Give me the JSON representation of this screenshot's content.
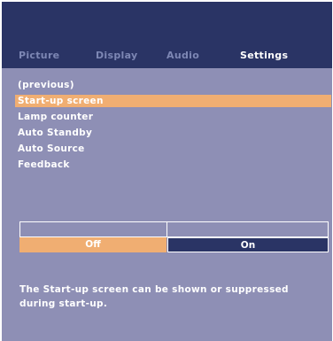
{
  "tabs": [
    {
      "label": "Picture",
      "active": false
    },
    {
      "label": "Display",
      "active": false
    },
    {
      "label": "Audio",
      "active": false
    },
    {
      "label": "Settings",
      "active": true
    }
  ],
  "menu": {
    "items": [
      {
        "label": "(previous)"
      },
      {
        "label": "Start-up screen",
        "selected": true
      },
      {
        "label": "Lamp counter"
      },
      {
        "label": "Auto Standby"
      },
      {
        "label": "Auto Source"
      },
      {
        "label": "Feedback"
      }
    ]
  },
  "toggle": {
    "off_label": "Off",
    "on_label": "On",
    "selected": "Off"
  },
  "help_text": "The Start-up screen can be shown or suppressed during start-up.",
  "colors": {
    "panel": "#8e8fb5",
    "header": "#2a3465",
    "highlight": "#f0ae72",
    "inactive_tab": "#7d87b4"
  }
}
